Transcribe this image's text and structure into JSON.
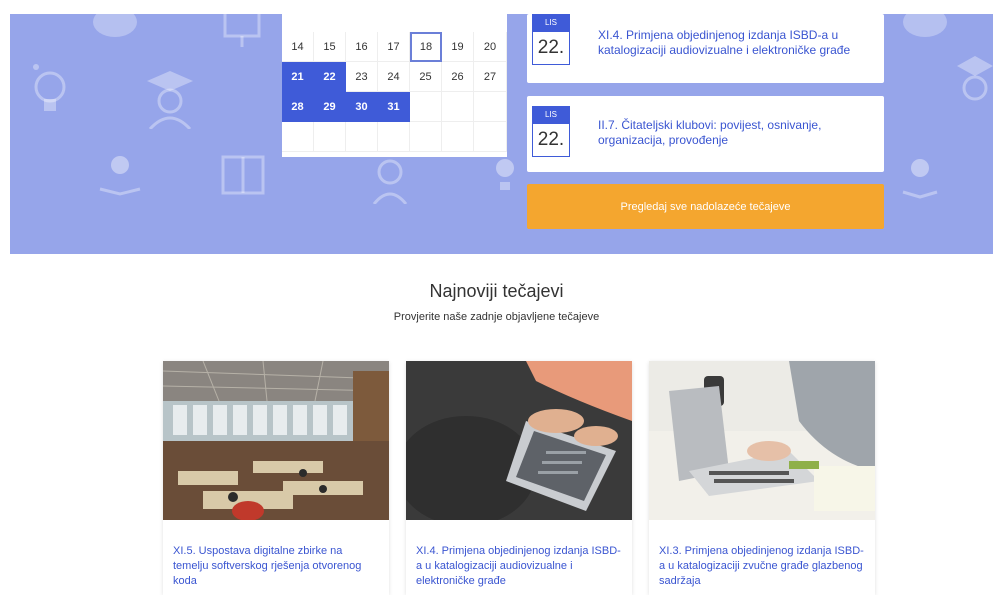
{
  "calendar": {
    "rows": [
      [
        "14",
        "15",
        "16",
        "17",
        "18",
        "19",
        "20"
      ],
      [
        "21",
        "22",
        "23",
        "24",
        "25",
        "26",
        "27"
      ],
      [
        "28",
        "29",
        "30",
        "31",
        "",
        "",
        ""
      ],
      [
        "",
        "",
        "",
        "",
        "",
        "",
        ""
      ]
    ],
    "selected": [
      "21",
      "22",
      "28",
      "29",
      "30",
      "31"
    ],
    "today": "18"
  },
  "events": [
    {
      "month": "LIS",
      "day": "22.",
      "title": "XI.4. Primjena objedinjenog izdanja ISBD-a u katalogizaciji audiovizualne i elektroničke građe"
    },
    {
      "month": "LIS",
      "day": "22.",
      "title": "II.7. Čitateljski klubovi: povijest, osnivanje, organizacija, provođenje"
    }
  ],
  "all_courses_button": "Pregledaj sve nadolazeće tečajeve",
  "section": {
    "title": "Najnoviji tečajevi",
    "subtitle": "Provjerite naše zadnje objavljene tečajeve"
  },
  "courses": [
    {
      "title": "XI.5. Uspostava digitalne zbirke na temelju softverskog rješenja otvorenog koda"
    },
    {
      "title": "XI.4. Primjena objedinjenog izdanja ISBD-a u katalogizaciji audiovizualne i elektroničke građe"
    },
    {
      "title": "XI.3. Primjena objedinjenog izdanja ISBD-a u katalogizaciji zvučne građe glazbenog sadržaja"
    }
  ],
  "colors": {
    "hero": "#96a5ea",
    "accent": "#3f5bd8",
    "button": "#f4a62f",
    "link": "#3a55d1"
  }
}
